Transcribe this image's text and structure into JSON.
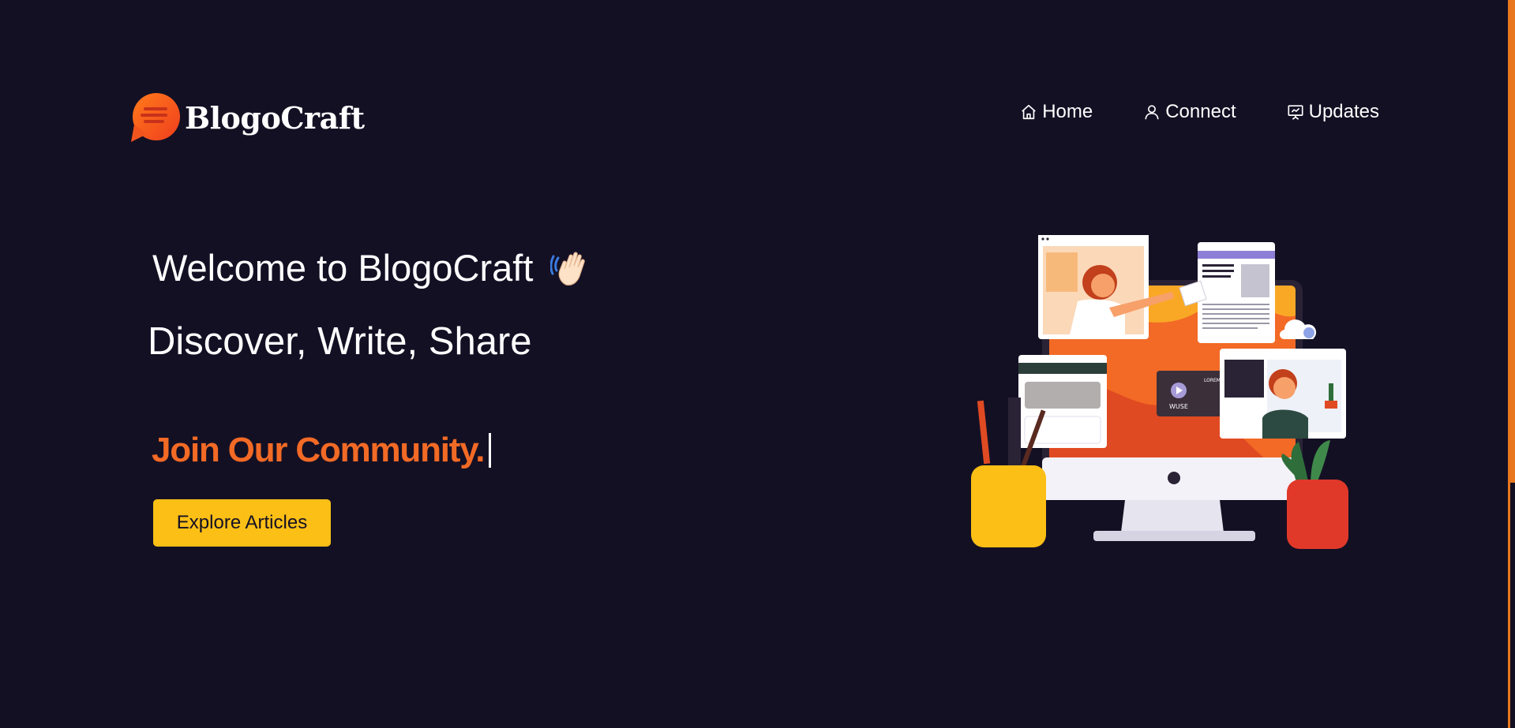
{
  "brand": {
    "name": "BlogoCraft",
    "logo_icon": "chat-bubble-icon",
    "accent": "#f26a25"
  },
  "nav": {
    "items": [
      {
        "label": "Home",
        "icon": "home-icon"
      },
      {
        "label": "Connect",
        "icon": "user-icon"
      },
      {
        "label": "Updates",
        "icon": "presentation-icon"
      }
    ]
  },
  "hero": {
    "welcome": "Welcome to BlogoCraft",
    "wave_icon": "waving-hand-icon",
    "tagline": "Discover, Write, Share",
    "typed_text": "Join Our Community.",
    "cta_label": "Explore Articles"
  },
  "colors": {
    "background": "#141024",
    "cta": "#fbbf16",
    "highlight": "#f26a25"
  },
  "illustration": {
    "icon": "desktop-workspace-illustration",
    "screen_label": "WUSE",
    "card_label": "LOREM"
  }
}
